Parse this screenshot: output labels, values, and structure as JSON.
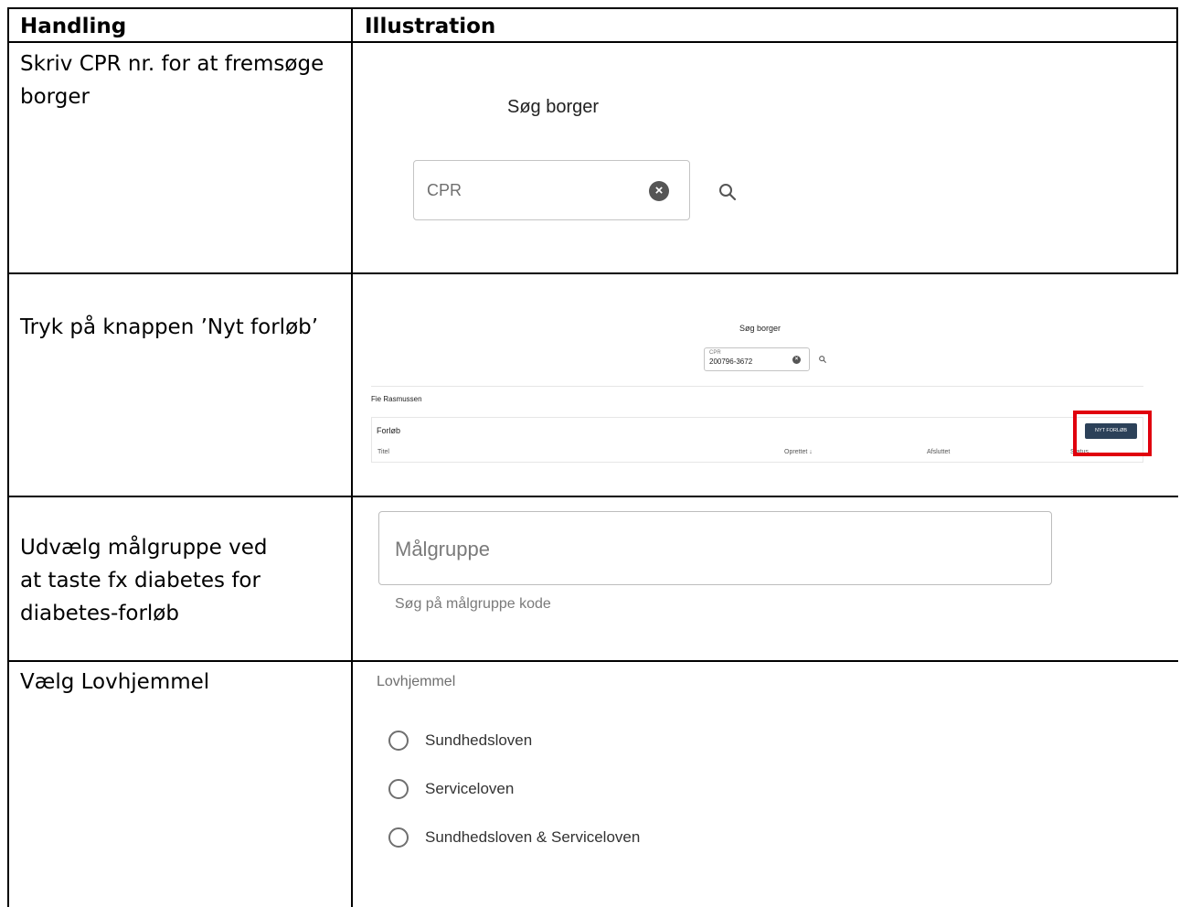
{
  "table": {
    "header": {
      "col1": "Handling",
      "col2": "Illustration"
    },
    "rows": [
      {
        "action": "Skriv CPR nr. for at fremsøge borger"
      },
      {
        "action": "Tryk på knappen ’Nyt forløb’"
      },
      {
        "action": "Udvælg målgruppe ved at taste fx diabetes for diabetes-forløb"
      },
      {
        "action": "Vælg Lovhjemmel"
      }
    ]
  },
  "search": {
    "title": "Søg borger",
    "placeholder": "CPR",
    "icon": "search-icon",
    "clear_icon": "clear-icon"
  },
  "citizen_view": {
    "title": "Søg borger",
    "cpr_label": "CPR",
    "cpr_value": "200796-3672",
    "citizen_name": "Fie Rasmussen",
    "card_title": "Forløb",
    "columns": [
      "Titel",
      "Oprettet ↓",
      "Afsluttet",
      "Status"
    ],
    "new_button_label": "NYT FORLØB",
    "highlight_color": "#e0000e",
    "button_color": "#2c4159"
  },
  "target_group": {
    "placeholder": "Målgruppe",
    "helper": "Søg på målgruppe kode"
  },
  "legal_basis": {
    "legend": "Lovhjemmel",
    "options": [
      "Sundhedsloven",
      "Serviceloven",
      "Sundhedsloven & Serviceloven"
    ]
  }
}
